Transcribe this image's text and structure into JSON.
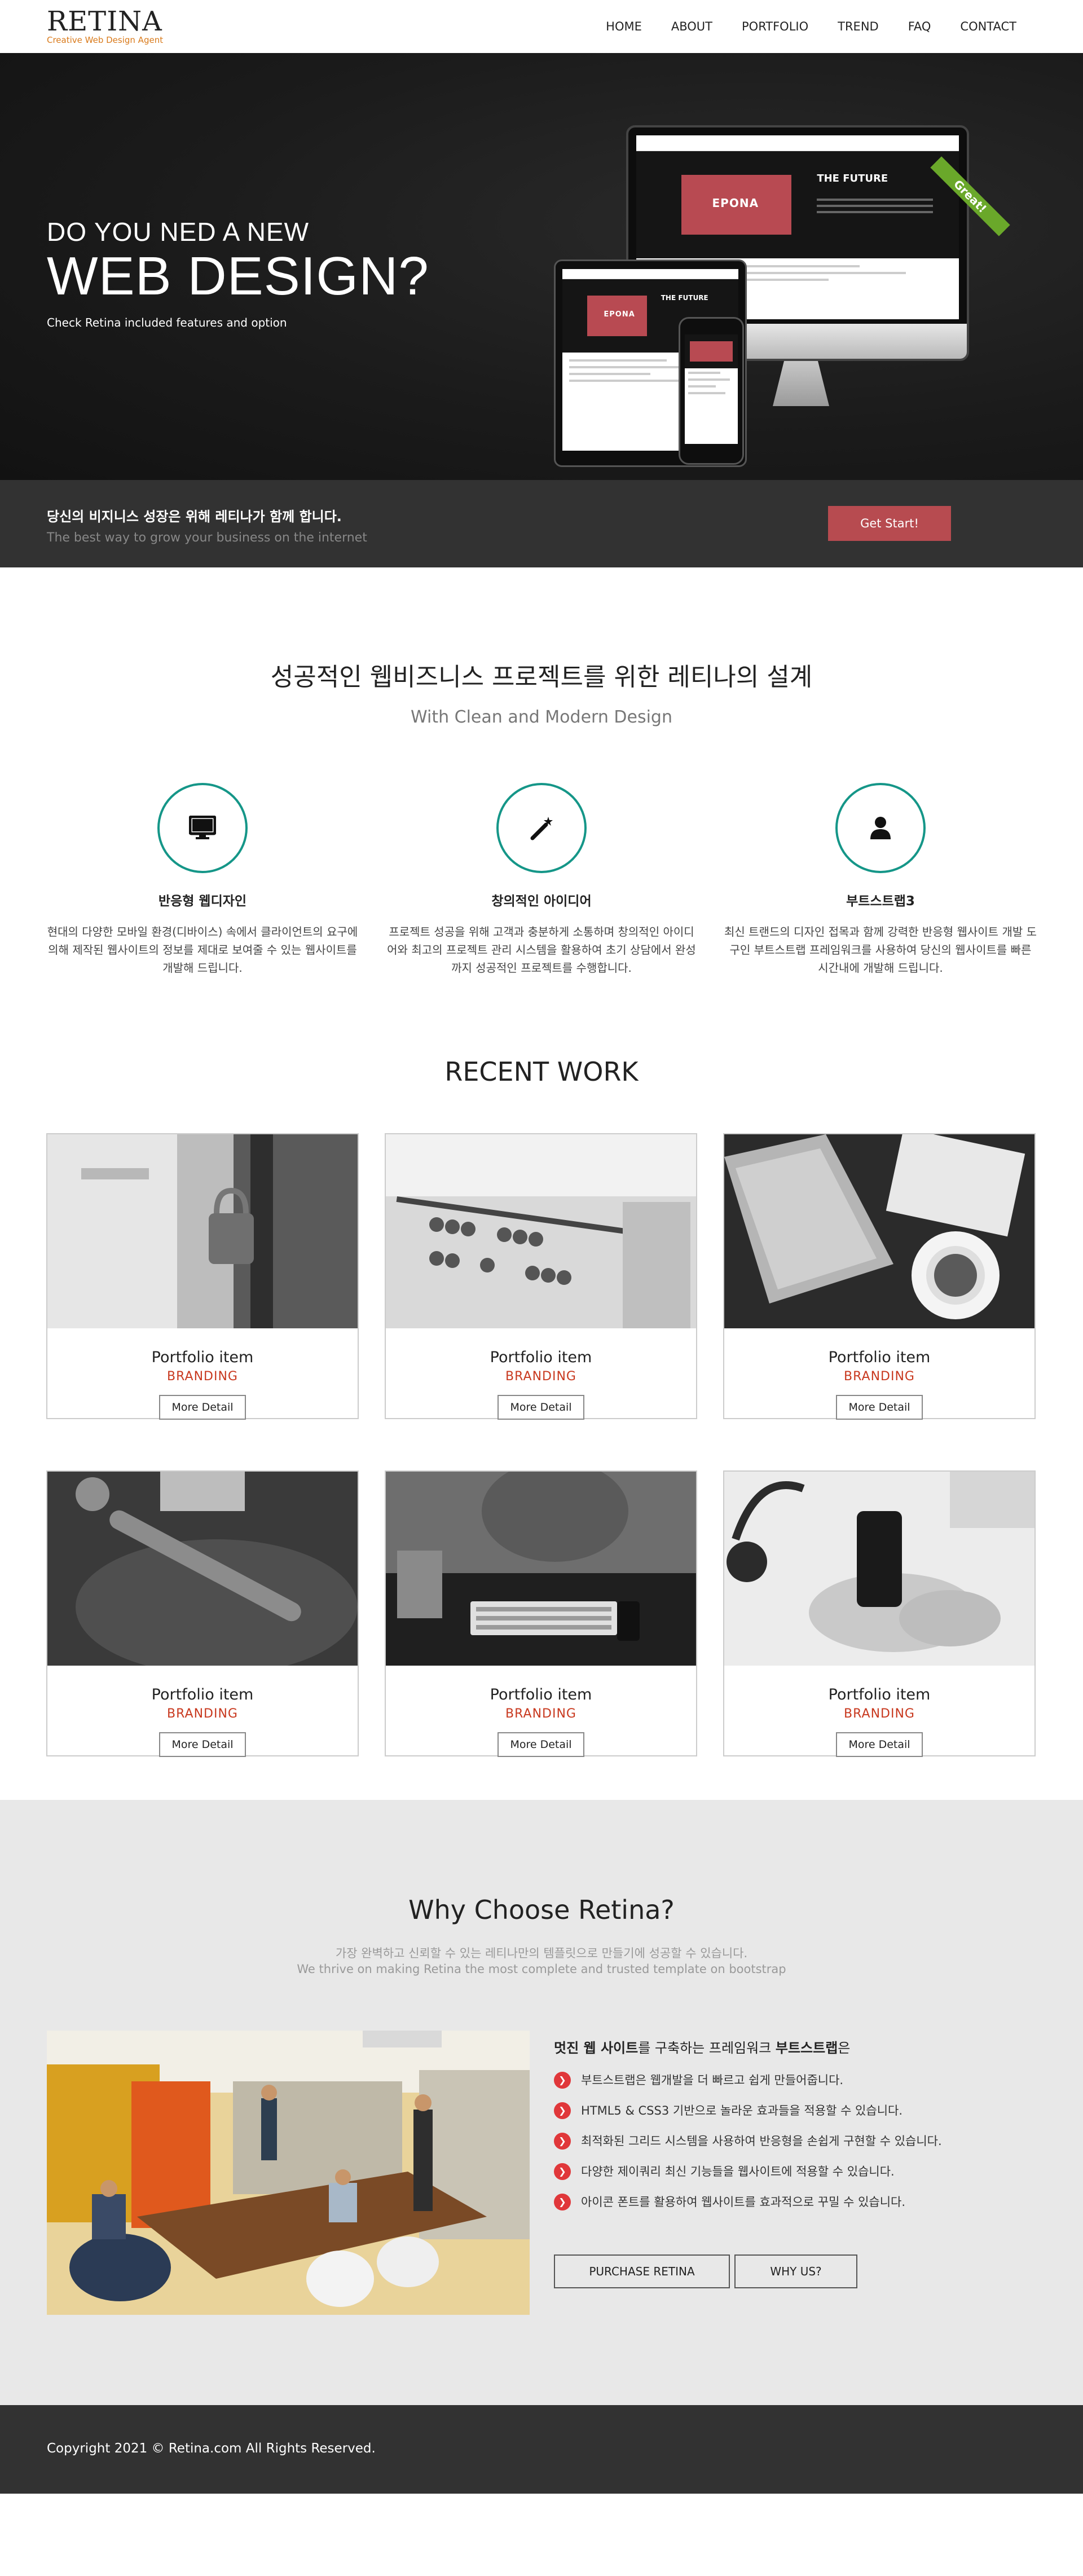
{
  "header": {
    "logo_name": "RETINA",
    "logo_tagline": "Creative Web Design Agent",
    "nav": [
      "HOME",
      "ABOUT",
      "PORTFOLIO",
      "TREND",
      "FAQ",
      "CONTACT"
    ]
  },
  "hero": {
    "line1": "DO YOU NED A NEW",
    "line2": "WEB DESIGN?",
    "subtitle": "Check Retina included features and option",
    "mockup_brand": "EPONA",
    "mockup_heading": "THE FUTURE",
    "badge": "Great!"
  },
  "cta": {
    "title": "당신의 비지니스 성장은 위해 레티나가 함께 합니다.",
    "subtitle": "The best way to grow your business on the internet",
    "button": "Get Start!"
  },
  "features": {
    "title": "성공적인 웹비즈니스 프로젝트를 위한 레티나의 설계",
    "subtitle": "With Clean and Modern Design",
    "items": [
      {
        "icon": "monitor-icon",
        "name": "반응형 웹디자인",
        "desc": "현대의 다양한 모바일 환경(디바이스) 속에서 클라이언트의 요구에 의해 제작된 웹사이트의 정보를 제대로 보여줄 수 있는 웹사이트를 개발해 드립니다."
      },
      {
        "icon": "magic-wand-icon",
        "name": "창의적인 아이디어",
        "desc": "프로젝트 성공을 위해 고객과 충분하게 소통하며 창의적인 아이디어와 최고의 프로젝트 관리 시스템을 활용하여 초기 상담에서 완성까지 성공적인 프로젝트를 수행합니다."
      },
      {
        "icon": "user-icon",
        "name": "부트스트랩3",
        "desc": "최신 트랜드의 디자인 접목과 함께 강력한 반응형 웹사이트 개발 도구인 부트스트랩 프레임워크를 사용하여 당신의 웹사이트를 빠른 시간내에 개발해 드립니다."
      }
    ]
  },
  "recent": {
    "title": "RECENT WORK",
    "items": [
      {
        "title": "Portfolio item",
        "category": "BRANDING",
        "button": "More Detail"
      },
      {
        "title": "Portfolio item",
        "category": "BRANDING",
        "button": "More Detail"
      },
      {
        "title": "Portfolio item",
        "category": "BRANDING",
        "button": "More Detail"
      },
      {
        "title": "Portfolio item",
        "category": "BRANDING",
        "button": "More Detail"
      },
      {
        "title": "Portfolio item",
        "category": "BRANDING",
        "button": "More Detail"
      },
      {
        "title": "Portfolio item",
        "category": "BRANDING",
        "button": "More Detail"
      }
    ]
  },
  "why": {
    "title": "Why Choose Retina?",
    "subtitle_ko": "가장 완벽하고 신뢰할 수 있는 레티나만의 템플릿으로 만들기에 성공할 수 있습니다.",
    "subtitle_en": "We thrive on making Retina the most complete and trusted template on bootstrap",
    "heading_bold1": "멋진 웹 사이트",
    "heading_mid": "를 구축하는 프레임워크 ",
    "heading_bold2": "부트스트랩",
    "heading_end": "은",
    "list": [
      "부트스트랩은 웹개발을 더 빠르고 쉽게 만들어줍니다.",
      "HTML5 & CSS3 기반으로 놀라운 효과들을 적용할 수 있습니다.",
      "최적화된 그리드 시스템을 사용하여 반응형을 손쉽게 구현할 수 있습니다.",
      "다양한 제이쿼리 최신 기능들을 웹사이트에 적용할 수 있습니다.",
      "아이콘 폰트를 활용하여 웹사이트를 효과적으로 꾸밀 수 있습니다."
    ],
    "btn_purchase": "PURCHASE RETINA",
    "btn_why": "WHY US?"
  },
  "footer": {
    "copyright": "Copyright 2021 © Retina.com All Rights Reserved."
  },
  "colors": {
    "accent_red": "#b74b50",
    "teal": "#159688",
    "category_red": "#c8381e",
    "dark_band": "#323232"
  }
}
